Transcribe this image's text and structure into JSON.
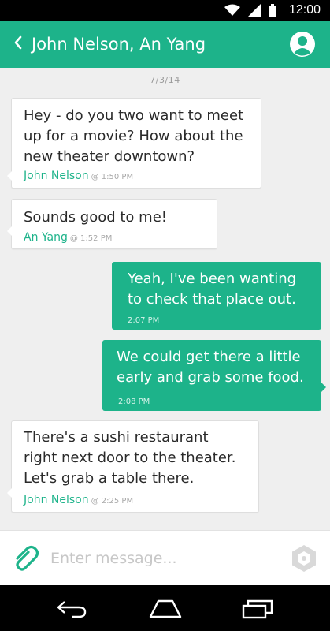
{
  "status_bar": {
    "time": "12:00",
    "icons": [
      "wifi-icon",
      "signal-icon",
      "battery-icon"
    ]
  },
  "header": {
    "title": "John Nelson, An Yang",
    "back_icon": "chevron-left-icon",
    "profile_icon": "person-icon"
  },
  "conversation": {
    "date": "7/3/14",
    "messages": [
      {
        "direction": "incoming",
        "lines": [
          "Hey - do you two want to meet",
          "up for a movie? How about the",
          "new theater downtown?"
        ],
        "author": "John Nelson",
        "time": "@ 1:50 PM"
      },
      {
        "direction": "incoming",
        "lines": [
          "Sounds good to me!"
        ],
        "author": "An Yang",
        "time": "@ 1:52 PM"
      },
      {
        "direction": "outgoing",
        "lines": [
          "Yeah, I've been wanting",
          "to check that place out."
        ],
        "time": "2:07 PM"
      },
      {
        "direction": "outgoing",
        "lines": [
          "We could get there a little",
          "early and grab some food."
        ],
        "time": "2:08 PM"
      },
      {
        "direction": "incoming",
        "lines": [
          "There's a sushi restaurant",
          "right next door to the theater.",
          "Let's grab a table there."
        ],
        "author": "John Nelson",
        "time": "@ 2:25 PM"
      }
    ]
  },
  "composer": {
    "placeholder": "Enter message...",
    "attach_icon": "paperclip-icon",
    "send_icon": "send-icon"
  },
  "nav_bar": {
    "icons": [
      "back-icon",
      "home-icon",
      "recents-icon"
    ]
  },
  "colors": {
    "accent": "#1db38a",
    "background": "#efefef",
    "bubble_incoming": "#ffffff"
  }
}
